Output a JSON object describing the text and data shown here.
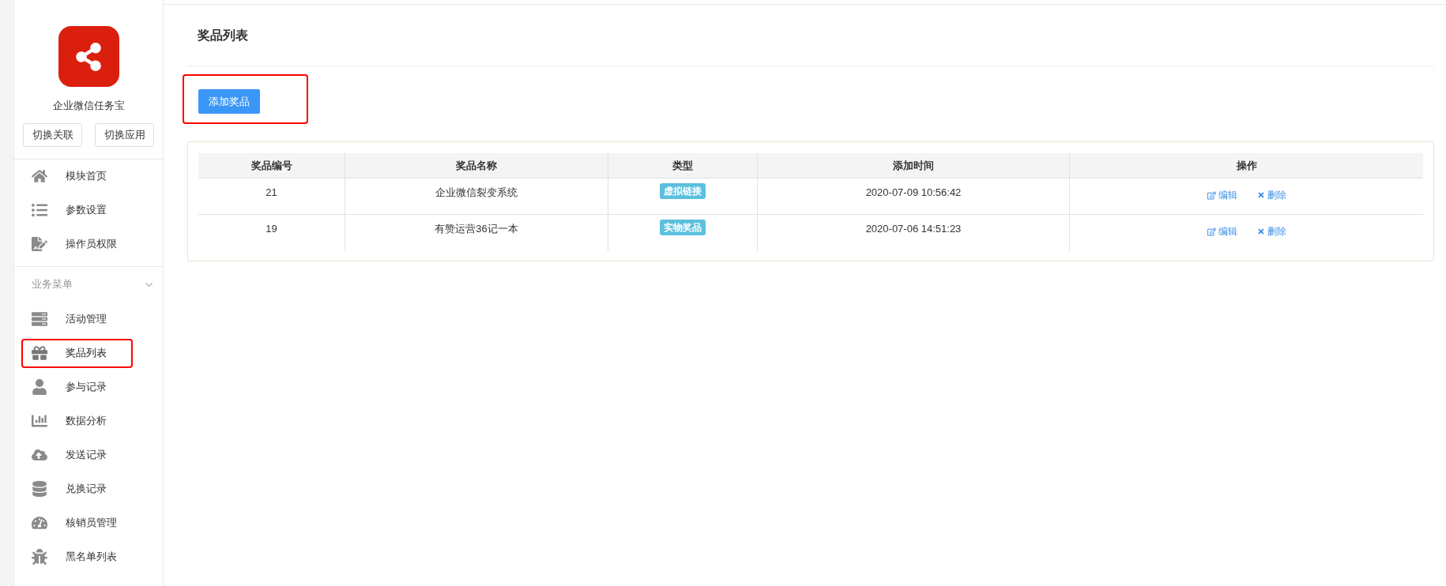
{
  "app": {
    "name": "企业微信任务宝",
    "buttons": [
      "切换关联",
      "切换应用"
    ]
  },
  "menu": [
    {
      "label": "模块首页",
      "kind": "home",
      "selected": false,
      "annotated": false
    },
    {
      "label": "参数设置",
      "kind": "list",
      "selected": false,
      "annotated": false
    },
    {
      "label": "操作员权限",
      "kind": "file",
      "selected": false,
      "annotated": false
    }
  ],
  "section": {
    "title": "业务菜单",
    "expanded": true,
    "items": [
      {
        "label": "活动管理",
        "kind": "server",
        "selected": false,
        "annotated": false
      },
      {
        "label": "奖品列表",
        "kind": "gift",
        "selected": true,
        "annotated": true
      },
      {
        "label": "参与记录",
        "kind": "user",
        "selected": false,
        "annotated": false
      },
      {
        "label": "数据分析",
        "kind": "chart",
        "selected": false,
        "annotated": false
      },
      {
        "label": "发送记录",
        "kind": "cloud",
        "selected": false,
        "annotated": false
      },
      {
        "label": "兑换记录",
        "kind": "database",
        "selected": false,
        "annotated": false
      },
      {
        "label": "核销员管理",
        "kind": "gauge",
        "selected": false,
        "annotated": false
      },
      {
        "label": "黑名单列表",
        "kind": "bug",
        "selected": false,
        "annotated": false
      }
    ]
  },
  "page": {
    "title": "奖品列表",
    "add_button": {
      "label": "添加奖品",
      "annotated": true
    }
  },
  "table": {
    "columns": [
      "奖品编号",
      "奖品名称",
      "类型",
      "添加时间",
      "操作"
    ],
    "rows": [
      {
        "id": "21",
        "name": "企业微信裂变系统",
        "type": "虚拟链接",
        "time": "2020-07-09 10:56:42",
        "actions": [
          "编辑",
          "删除"
        ]
      },
      {
        "id": "19",
        "name": "有赞运营36记一本",
        "type": "实物奖品",
        "time": "2020-07-06 14:51:23",
        "actions": [
          "编辑",
          "删除"
        ]
      }
    ]
  }
}
